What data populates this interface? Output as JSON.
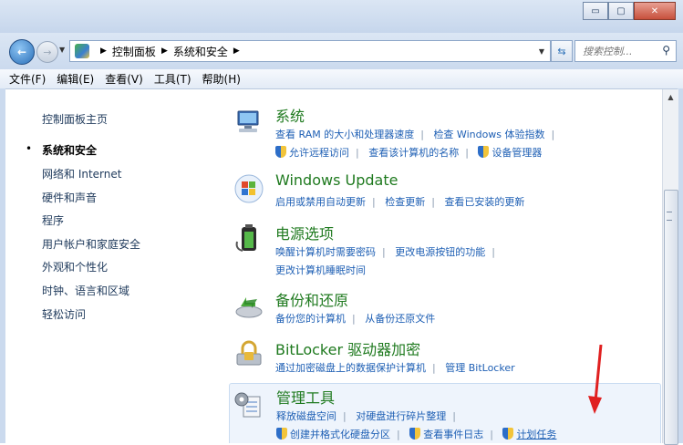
{
  "window": {
    "minimize_label": "▭",
    "maximize_label": "▢",
    "close_label": "✕"
  },
  "address": {
    "crumbs": [
      "控制面板",
      "系统和安全"
    ],
    "search_placeholder": "搜索控制..."
  },
  "menu": [
    "文件(F)",
    "编辑(E)",
    "查看(V)",
    "工具(T)",
    "帮助(H)"
  ],
  "sidebar": {
    "home": "控制面板主页",
    "items": [
      "系统和安全",
      "网络和 Internet",
      "硬件和声音",
      "程序",
      "用户帐户和家庭安全",
      "外观和个性化",
      "时钟、语言和区域",
      "轻松访问"
    ]
  },
  "categories": [
    {
      "title": "系统",
      "icon": "computer-icon",
      "row1": [
        "查看 RAM 的大小和处理器速度",
        "检查 Windows 体验指数"
      ],
      "row2": [
        "允许远程访问",
        "查看该计算机的名称",
        "设备管理器"
      ]
    },
    {
      "title": "Windows Update",
      "icon": "windows-update-icon",
      "row1": [
        "启用或禁用自动更新",
        "检查更新",
        "查看已安装的更新"
      ]
    },
    {
      "title": "电源选项",
      "icon": "battery-icon",
      "row1": [
        "唤醒计算机时需要密码",
        "更改电源按钮的功能"
      ],
      "row2": [
        "更改计算机睡眠时间"
      ]
    },
    {
      "title": "备份和还原",
      "icon": "backup-icon",
      "row1": [
        "备份您的计算机",
        "从备份还原文件"
      ]
    },
    {
      "title": "BitLocker 驱动器加密",
      "icon": "bitlocker-icon",
      "row1": [
        "通过加密磁盘上的数据保护计算机",
        "管理 BitLocker"
      ]
    },
    {
      "title": "管理工具",
      "icon": "admin-tools-icon",
      "row1": [
        "释放磁盘空间",
        "对硬盘进行碎片整理"
      ],
      "row2": [
        "创建并格式化硬盘分区",
        "查看事件日志",
        "计划任务"
      ]
    }
  ],
  "colors": {
    "title_green": "#1f7a1f",
    "link_blue": "#1e5fb4",
    "arrow_red": "#e02020"
  }
}
